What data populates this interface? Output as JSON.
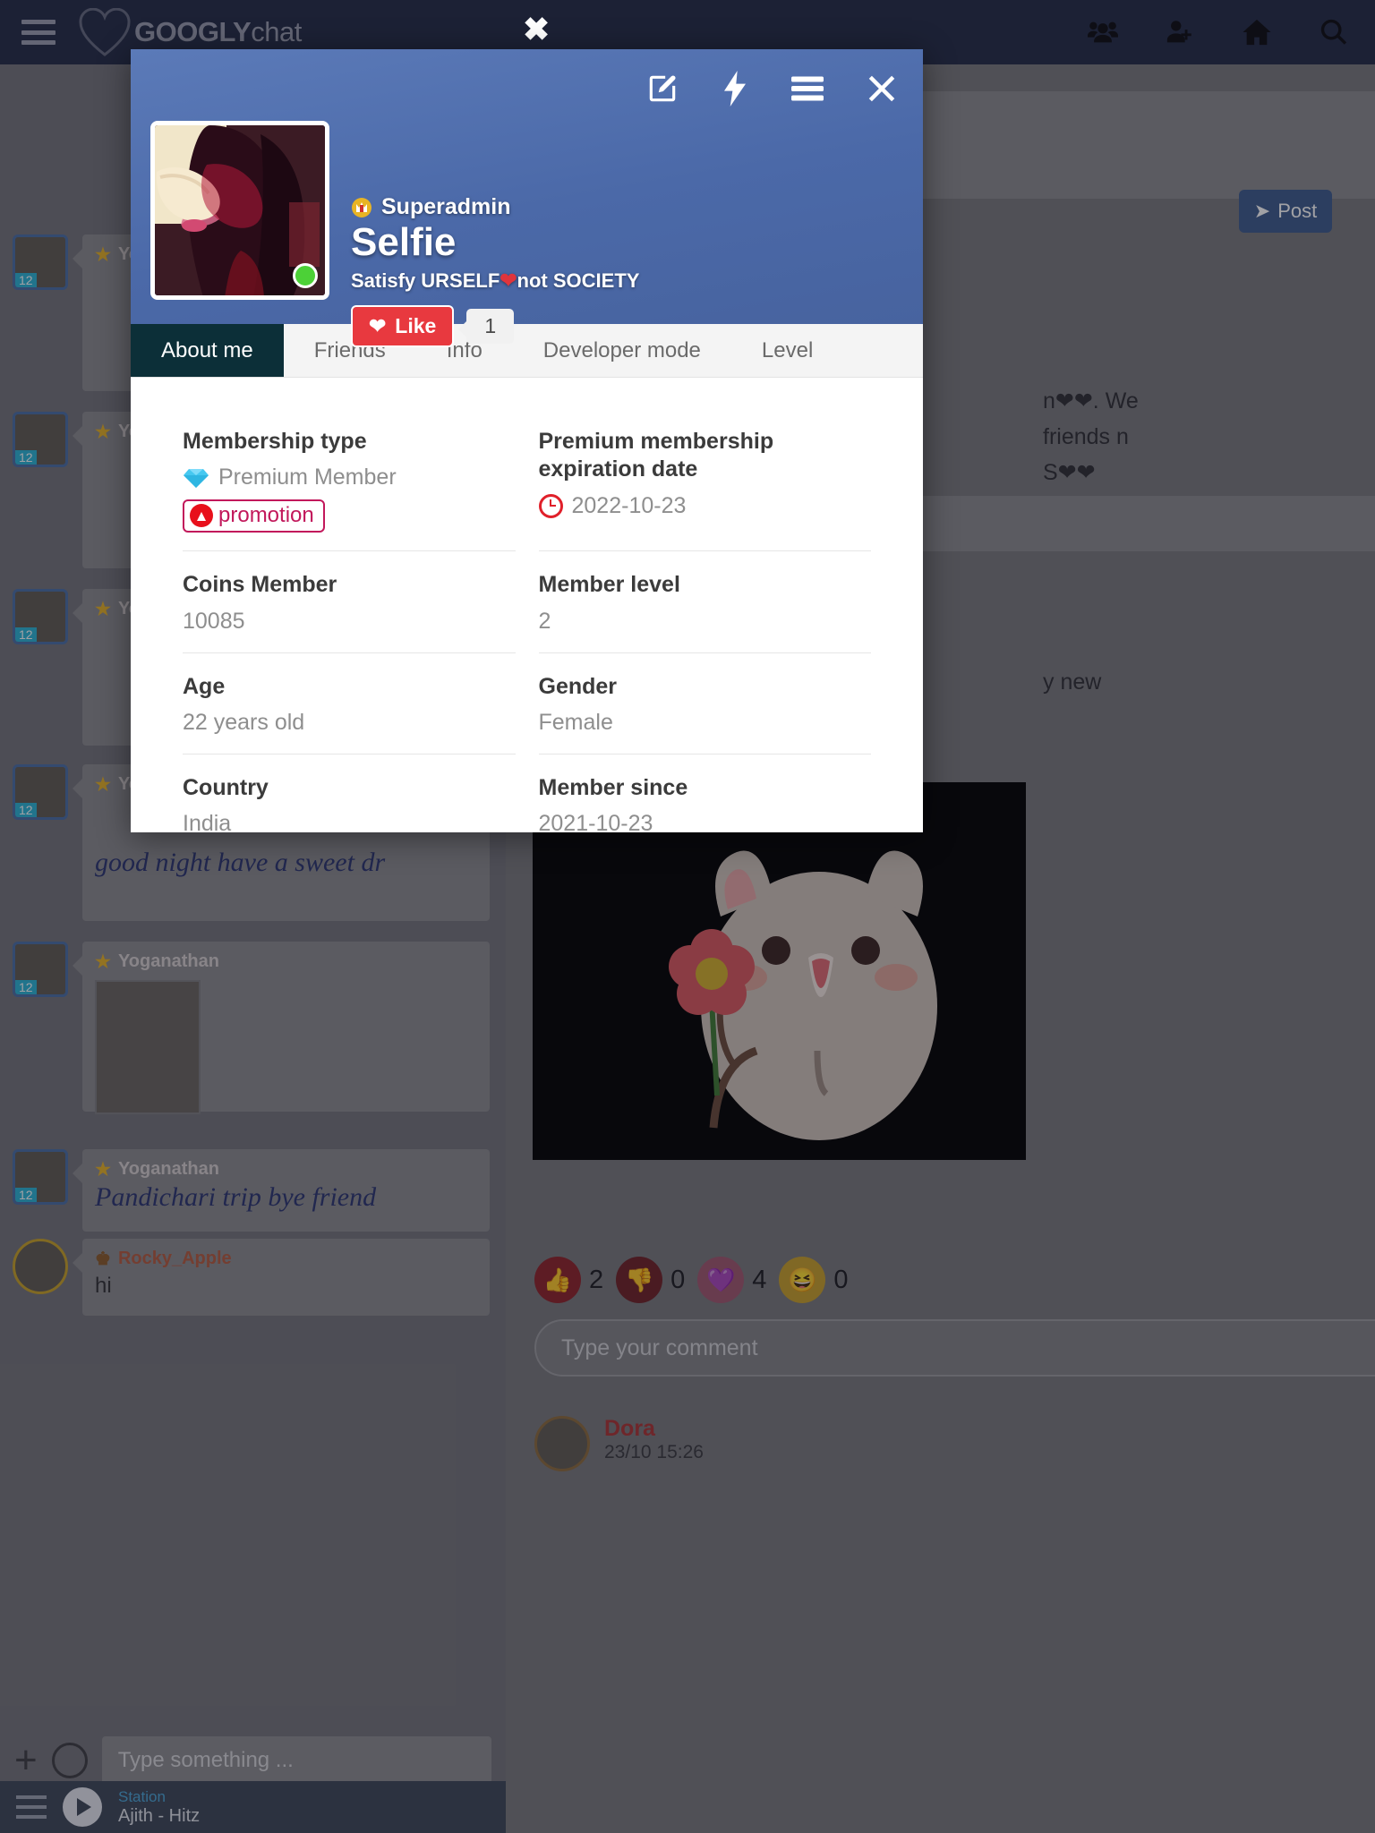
{
  "navbar": {
    "menu_icon": "hamburger-icon",
    "brand_bold": "GOOGLY",
    "brand_light": "chat",
    "icons": [
      "users-group-icon",
      "add-friend-icon",
      "home-icon",
      "search-icon"
    ]
  },
  "background": {
    "post_button": "Post",
    "composer_placeholder": "Type something ...",
    "player": {
      "station_label": "Station",
      "track": "Ajith - Hitz"
    },
    "messages": [
      {
        "name": "Yoganathan",
        "text": ""
      },
      {
        "name": "Yoganathan",
        "text": ""
      },
      {
        "name": "Yoganathan",
        "text": ""
      },
      {
        "name": "Yoganathan",
        "text": "good night have a sweet dr"
      },
      {
        "name": "Yoganathan",
        "text": ""
      },
      {
        "name": "Yoganathan",
        "text": "Pandichari trip bye friend"
      },
      {
        "name": "Rocky_Apple",
        "text": "hi",
        "badge": "2"
      }
    ],
    "feed_snippets": [
      "n❤❤. We",
      "friends n",
      "S❤❤",
      "y new"
    ],
    "reactions": [
      {
        "icon": "thumbs-up-icon",
        "count": "2"
      },
      {
        "icon": "thumbs-down-icon",
        "count": "0"
      },
      {
        "icon": "heart-icon",
        "count": "4"
      },
      {
        "icon": "laugh-icon",
        "count": "0"
      }
    ],
    "comment_placeholder": "Type your comment",
    "commenter": {
      "name": "Dora",
      "time": "23/10 15:26"
    }
  },
  "modal": {
    "close_outside": "✖",
    "tools": [
      {
        "name": "edit-icon",
        "label": "Edit profile"
      },
      {
        "name": "lightning-icon",
        "label": "Boost"
      },
      {
        "name": "hamburger-icon",
        "label": "Menu"
      },
      {
        "name": "close-icon",
        "label": "Close"
      }
    ],
    "profile": {
      "role_badge_icon": "crown-icon",
      "role": "Superadmin",
      "name": "Selfie",
      "tagline_before": "Satisfy URSELF",
      "tagline_heart": "❤",
      "tagline_after": "not SOCIETY",
      "like_label": "Like",
      "like_icon": "heart-icon",
      "like_count": "1",
      "online_status": "online"
    },
    "tabs": [
      {
        "label": "About me",
        "active": true
      },
      {
        "label": "Friends",
        "active": false
      },
      {
        "label": "Info",
        "active": false
      },
      {
        "label": "Developer mode",
        "active": false
      },
      {
        "label": "Level",
        "active": false
      }
    ],
    "about": {
      "rows": [
        {
          "label": "Membership type",
          "value": "Premium Member",
          "icon": "diamond-icon",
          "badge": {
            "text": "promotion",
            "icon": "arrow-up-circle-icon"
          }
        },
        {
          "label": "Premium membership expiration date",
          "value": "2022-10-23",
          "icon": "clock-icon"
        },
        {
          "label": "Coins Member",
          "value": "10085",
          "icon": ""
        },
        {
          "label": "Member level",
          "value": "2",
          "icon": ""
        },
        {
          "label": "Age",
          "value": "22 years old",
          "icon": ""
        },
        {
          "label": "Gender",
          "value": "Female",
          "icon": ""
        },
        {
          "label": "Country",
          "value": "India",
          "icon": ""
        },
        {
          "label": "Member since",
          "value": "2021-10-23",
          "icon": ""
        }
      ]
    }
  },
  "colors": {
    "navbar": "#222b45",
    "modal_header": "#4b69a8",
    "tab_active": "#0c2f38",
    "like_red": "#e8393f",
    "promo": "#c2185b",
    "clock_red": "#e0202a",
    "online_green": "#4cd137"
  }
}
